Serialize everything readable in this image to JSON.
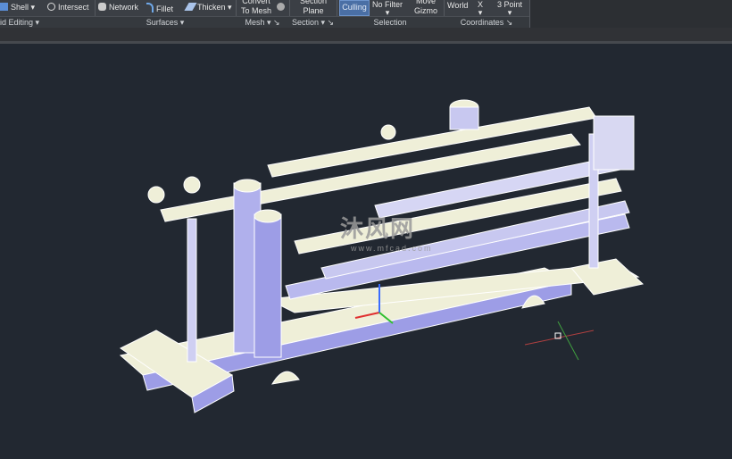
{
  "ribbon": {
    "panels": [
      {
        "label": "id Editing",
        "buttons": [
          "Shell",
          "Intersect"
        ]
      },
      {
        "label": "Surfaces",
        "buttons": [
          "Network",
          "Fillet",
          "Thicken"
        ]
      },
      {
        "label": "Mesh",
        "buttons": [
          "Convert To Mesh"
        ]
      },
      {
        "label": "Section",
        "buttons": [
          "Section Plane"
        ]
      },
      {
        "label": "Selection",
        "buttons": [
          "Culling",
          "No Filter",
          "Move Gizmo"
        ]
      },
      {
        "label": "Coordinates",
        "buttons": [
          "World",
          "X",
          "3 Point"
        ]
      }
    ]
  },
  "viewport": {
    "watermark_cn": "沐风网",
    "watermark_url": "www.mfcad.com",
    "background": "#222831",
    "model_face_color": "#efefd8",
    "model_shade_color": "#9d9de6"
  }
}
